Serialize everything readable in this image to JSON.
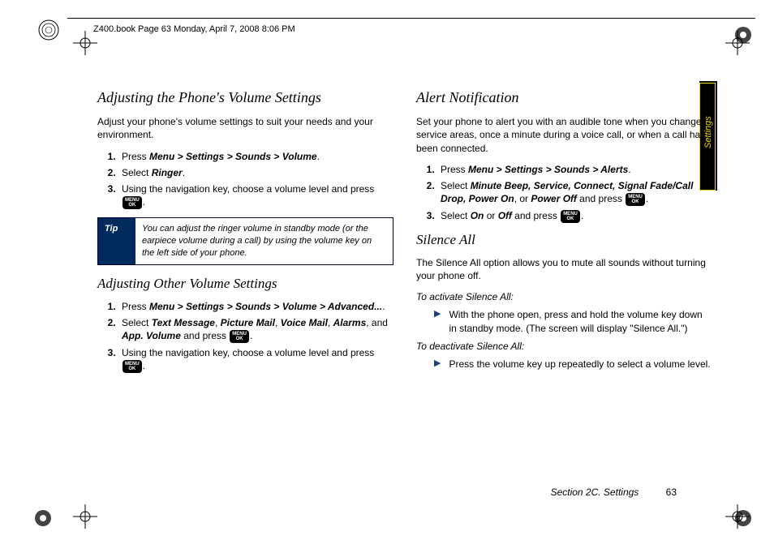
{
  "header": "Z400.book  Page 63  Monday, April 7, 2008  8:06 PM",
  "side_tab": "Settings",
  "menu_btn_line1": "MENU",
  "menu_btn_line2": "OK",
  "left": {
    "h1": "Adjusting the Phone's Volume Settings",
    "intro": "Adjust your phone's volume settings to suit your needs and your environment.",
    "s1_pre": "Press ",
    "s1_path": "Menu > Settings > Sounds > Volume",
    "s2_pre": "Select ",
    "s2_path": "Ringer",
    "s3": "Using the navigation key, choose a volume level and press ",
    "tip_label": "Tip",
    "tip_text": "You can adjust the ringer volume in standby mode (or the earpiece volume during a call) by using the volume key on the left side of your phone.",
    "h2": "Adjusting Other Volume Settings",
    "b1_pre": "Press ",
    "b1_path": "Menu > Settings > Sounds > Volume > Advanced...",
    "b2_pre": "Select ",
    "b2_p1": "Text Message",
    "b2_p2": "Picture Mail",
    "b2_p3": "Voice Mail",
    "b2_p4": "Alarms",
    "b2_and": ", and ",
    "b2_p5": "App. Volume",
    "b2_post": " and press ",
    "b3": "Using the navigation key, choose a volume level and press "
  },
  "right": {
    "h1": "Alert Notification",
    "intro": "Set your phone to alert you with an audible tone when you change service areas, once a minute during a voice call, or when a call has been connected.",
    "s1_pre": "Press ",
    "s1_path": "Menu > Settings > Sounds > Alerts",
    "s2_pre": "Select ",
    "s2_path": "Minute Beep, Service, Connect, Signal Fade/Call Drop, Power On",
    "s2_or": ", or ",
    "s2_path2": "Power Off",
    "s2_post": " and press ",
    "s3_pre": "Select ",
    "s3_on": "On",
    "s3_or": " or ",
    "s3_off": "Off",
    "s3_post": " and press ",
    "h2": "Silence All",
    "intro2": "The Silence All option allows you to mute all sounds without turning your phone off.",
    "sub1": "To activate Silence All:",
    "bul1": "With the phone open, press and hold the volume key down in standby mode. (The screen will display \"Silence All.\")",
    "sub2": "To deactivate Silence All:",
    "bul2": "Press the volume key up repeatedly to select a volume level."
  },
  "footer_section": "Section 2C. Settings",
  "footer_page": "63"
}
